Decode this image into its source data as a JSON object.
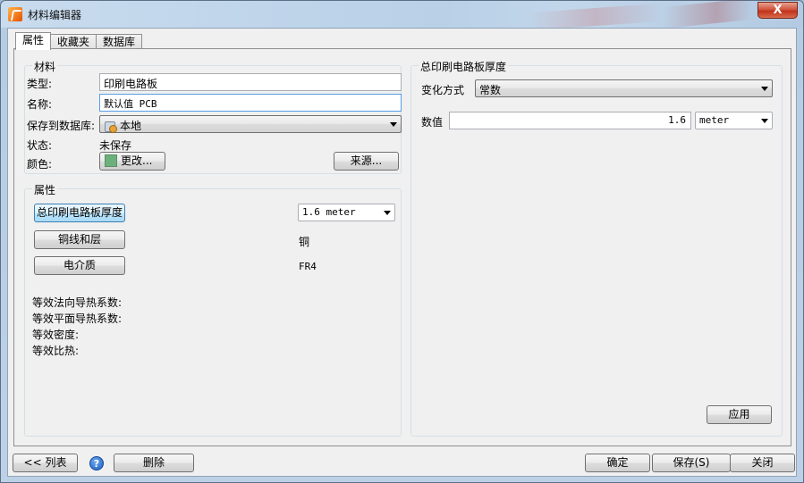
{
  "window": {
    "title": "材料编辑器",
    "close_label": "X"
  },
  "tabs": [
    {
      "label": "属性"
    },
    {
      "label": "收藏夹"
    },
    {
      "label": "数据库"
    }
  ],
  "material": {
    "group_title": "材料",
    "type_label": "类型:",
    "type_value": "印刷电路板",
    "name_label": "名称:",
    "name_value": "默认值 PCB",
    "savedb_label": "保存到数据库:",
    "savedb_value": "本地",
    "status_label": "状态:",
    "status_value": "未保存",
    "color_label": "颜色:",
    "color_swatch": "#6cb17b",
    "change_button": "更改...",
    "source_button": "来源..."
  },
  "properties": {
    "group_title": "属性",
    "thickness_button": "总印刷电路板厚度",
    "thickness_value": "1.6 meter",
    "copper_button": "铜线和层",
    "copper_value": "铜",
    "dielectric_button": "电介质",
    "dielectric_value": "FR4",
    "equiv_normal": "等效法向导热系数:",
    "equiv_plane": "等效平面导热系数:",
    "equiv_density": "等效密度:",
    "equiv_specific_heat": "等效比热:"
  },
  "thickness_panel": {
    "group_title": "总印刷电路板厚度",
    "variation_label": "变化方式",
    "variation_value": "常数",
    "value_label": "数值",
    "value": "1.6",
    "unit": "meter",
    "apply_button": "应用"
  },
  "footer": {
    "list_button": "<< 列表",
    "help_icon": "?",
    "delete_button": "删除",
    "ok_button": "确定",
    "save_button": "保存(S)",
    "close_button": "关闭"
  }
}
